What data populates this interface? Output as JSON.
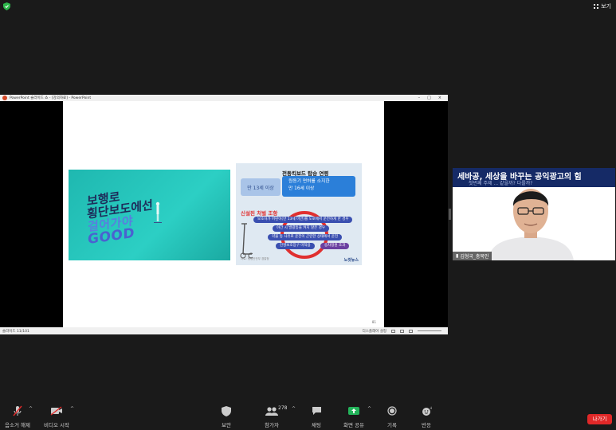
{
  "top": {
    "view_label": "보기"
  },
  "ppt": {
    "window_title": "PowerPoint 슬라이드 쇼 - [강의자료] - PowerPoint",
    "controls": [
      "–",
      "□",
      "×"
    ],
    "status_left": "슬라이드 11/101",
    "status_right": "디스플레이 설정",
    "page_number": "81"
  },
  "slide": {
    "left_image": {
      "line1": "보행로",
      "line2": "횡단보도에선",
      "line3": "걸어가야",
      "line4": "GOOD"
    },
    "right_image": {
      "title": "전동킥보드 탑승 연령",
      "age_old": "만 13세 이상",
      "age_new_l1": "원동기 면허를 소지한",
      "age_new_l2": "만 16세 이상",
      "new_rules": "신설된 처벌 조항",
      "rules": [
        "보호자가 어린이(만 13세 미만)를 도로에서 운전하게 한 경우",
        "야간 시 발광등을 켜지 않은 경우",
        "약물 등 사유로 운전이 곤란한 상태에서 운전",
        "인명보호장구 미착용",
        "승차정원 초과"
      ],
      "footer": "자료: 행정안전부 경찰청",
      "logo": "노컷뉴스"
    }
  },
  "video": {
    "banner_title": "세바공, 세상을 바꾸는 공익광고의 힘",
    "banner_sub": "첫번째 주제 ... 같을까? 다를까?",
    "participant_name": "김형국_충북인"
  },
  "toolbar": {
    "audio": "음소거 해제",
    "video": "비디오 시작",
    "security": "보안",
    "participants_count": "278",
    "participants": "참가자",
    "chat": "채팅",
    "share": "화면 공유",
    "record": "기록",
    "reactions": "반응",
    "leave": "나가기"
  }
}
